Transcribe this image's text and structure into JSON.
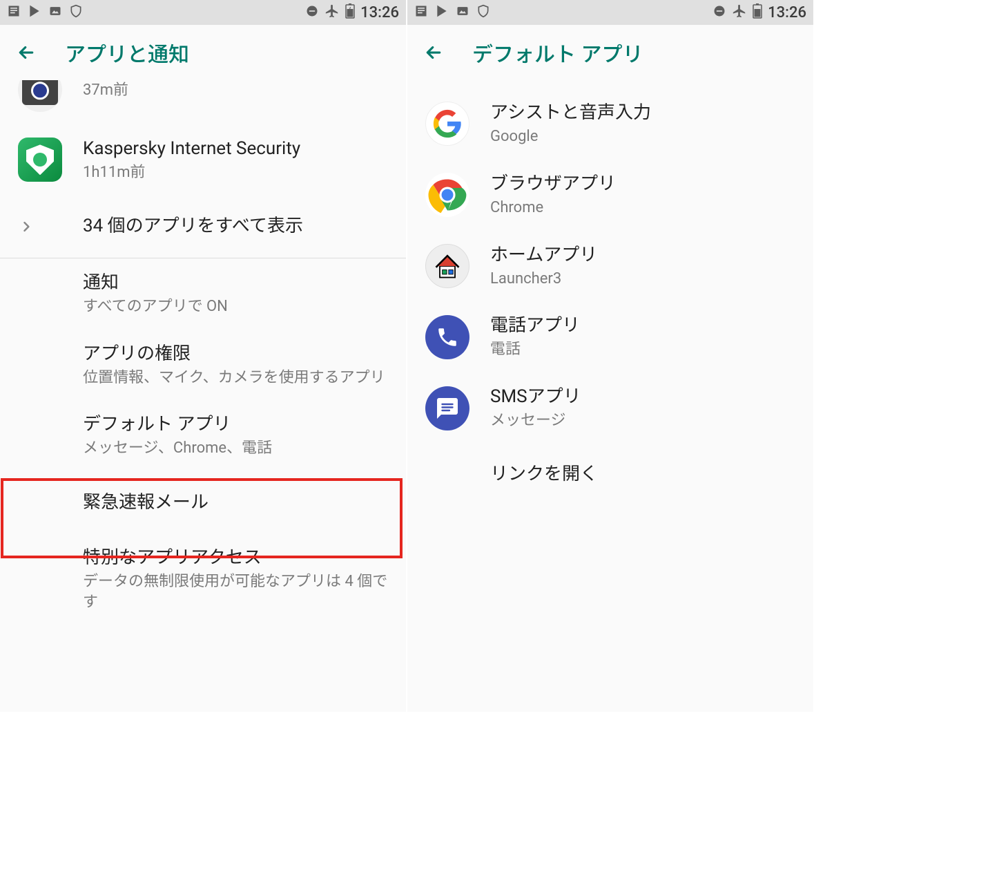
{
  "status": {
    "time": "13:26"
  },
  "left": {
    "title": "アプリと通知",
    "camera": {
      "sub": "37m前"
    },
    "kaspersky": {
      "title": "Kaspersky Internet Security",
      "sub": "1h11m前"
    },
    "show_all": {
      "title": "34 個のアプリをすべて表示"
    },
    "notifications": {
      "title": "通知",
      "sub": "すべてのアプリで ON"
    },
    "permissions": {
      "title": "アプリの権限",
      "sub": "位置情報、マイク、カメラを使用するアプリ"
    },
    "default_apps": {
      "title": "デフォルト アプリ",
      "sub": "メッセージ、Chrome、電話"
    },
    "emergency": {
      "title": "緊急速報メール"
    },
    "special": {
      "title": "特別なアプリアクセス",
      "sub": "データの無制限使用が可能なアプリは 4 個です"
    }
  },
  "right": {
    "title": "デフォルト アプリ",
    "assist": {
      "title": "アシストと音声入力",
      "sub": "Google"
    },
    "browser": {
      "title": "ブラウザアプリ",
      "sub": "Chrome"
    },
    "home": {
      "title": "ホームアプリ",
      "sub": "Launcher3"
    },
    "phone": {
      "title": "電話アプリ",
      "sub": "電話"
    },
    "sms": {
      "title": "SMSアプリ",
      "sub": "メッセージ"
    },
    "links": {
      "title": "リンクを開く"
    }
  }
}
